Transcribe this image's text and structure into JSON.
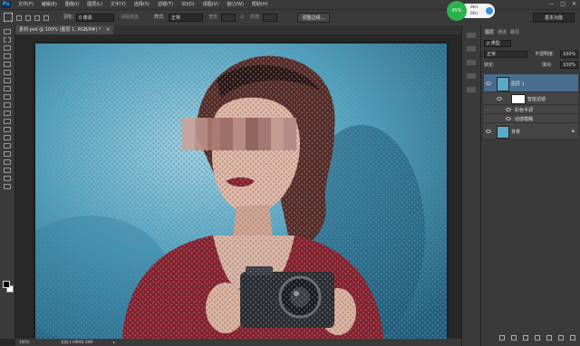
{
  "app": {
    "logo": "Ps"
  },
  "menubar": [
    "文件(F)",
    "编辑(E)",
    "图像(I)",
    "图层(L)",
    "文字(Y)",
    "选择(S)",
    "滤镜(T)",
    "3D(D)",
    "视图(V)",
    "窗口(W)",
    "帮助(H)"
  ],
  "window_controls": [
    "—",
    "□",
    "✕"
  ],
  "options": {
    "feather_label": "羽化:",
    "feather_value": "0 像素",
    "antialias_label": "消除锯齿",
    "style_label": "样式:",
    "style_value": "正常",
    "width_label": "宽度:",
    "height_label": "高度:",
    "refine_edge_button": "调整边缘...",
    "workspace": "基本功能"
  },
  "perf_widget": {
    "percent": "45%",
    "upload": "0K/s",
    "download": "0K/s"
  },
  "document": {
    "tab_title": "素材.psd @ 100% (图层 1, RGB/8#) *",
    "close_glyph": "×"
  },
  "status": {
    "zoom": "100%",
    "doc_info": "文档:1.09M/4.28M",
    "arrow": "▸"
  },
  "panel": {
    "tabs": [
      "图层",
      "通道",
      "路径"
    ],
    "filter_kind": "ρ 类型",
    "blend_mode": "正常",
    "opacity_label": "不透明度:",
    "opacity_value": "100%",
    "lock_label": "锁定:",
    "fill_label": "填充:",
    "fill_value": "100%",
    "layers": [
      {
        "name": "图层 1",
        "selected": true
      },
      {
        "name": "智能滤镜"
      },
      {
        "name": "彩色半调"
      },
      {
        "name": "动感模糊"
      },
      {
        "name": "背景"
      }
    ]
  },
  "colors": {
    "accent_green": "#2bb24c",
    "selection": "#4a6c8e",
    "chrome": "#3a3a3a"
  }
}
